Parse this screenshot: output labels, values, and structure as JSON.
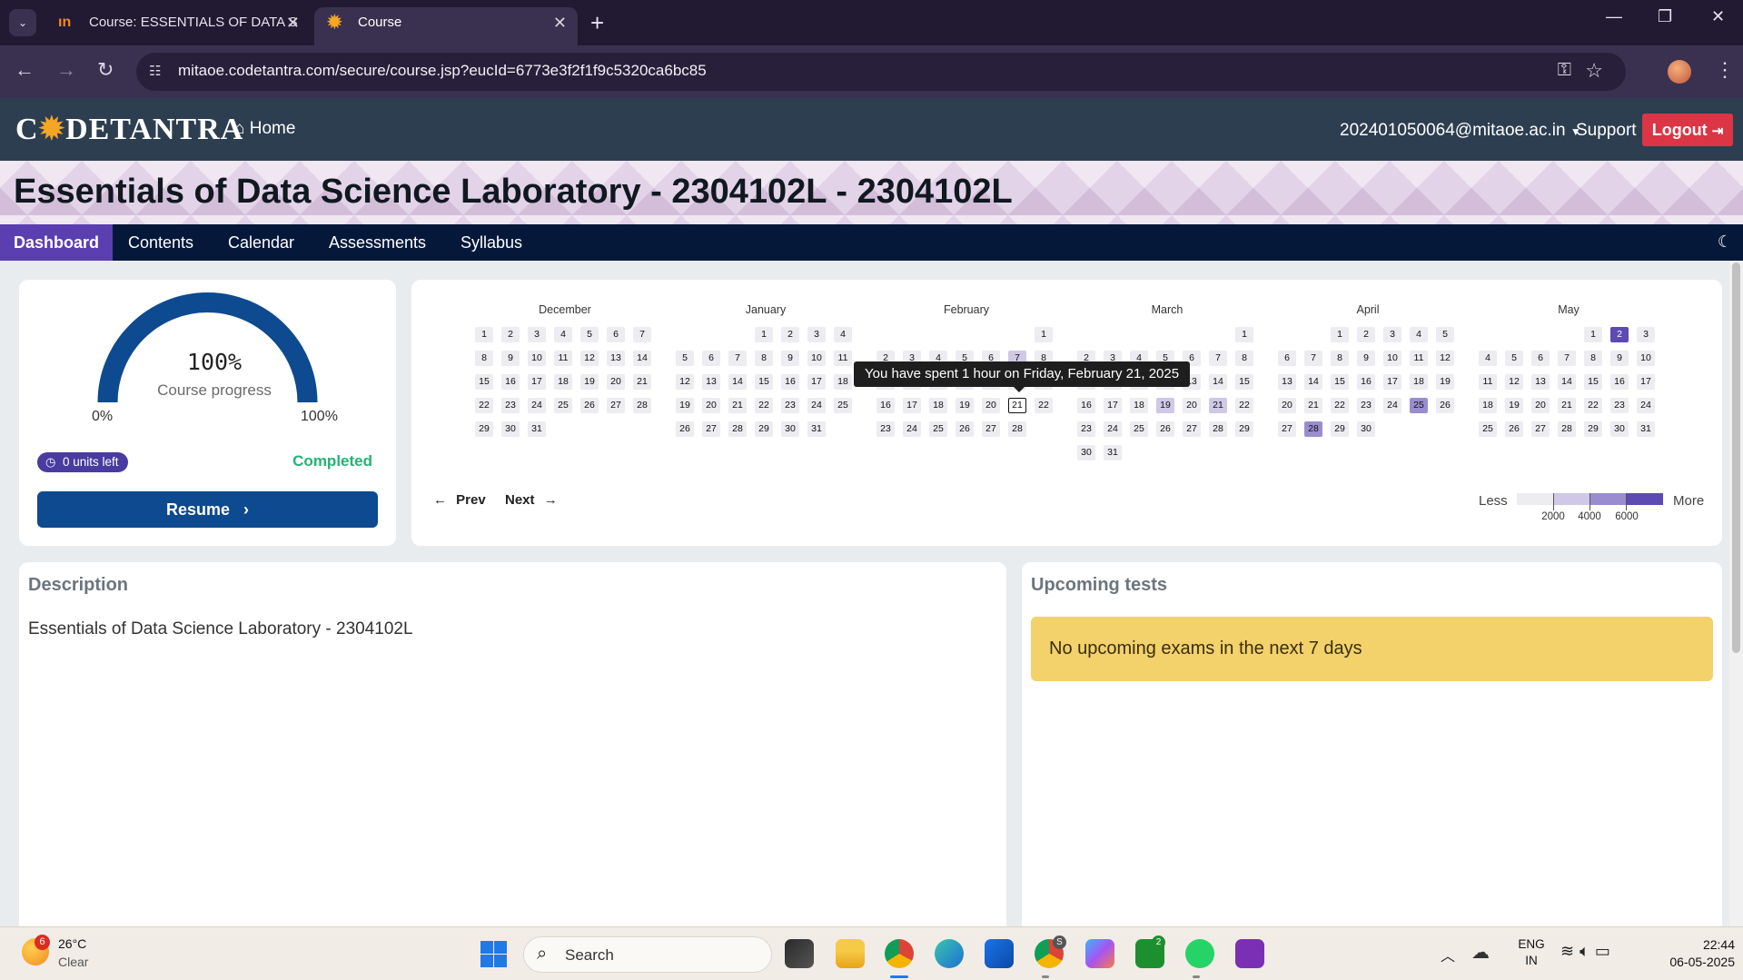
{
  "browser": {
    "tabs": [
      {
        "title": "Course: ESSENTIALS OF DATA S",
        "favicon": "codetantra-favicon"
      },
      {
        "title": "Course",
        "favicon": "sun-favicon",
        "active": true
      }
    ],
    "url": "mitaoe.codetantra.com/secure/course.jsp?eucId=6773e3f2f1f9c5320ca6bc85"
  },
  "header": {
    "logo": {
      "pre": "C",
      "sun": "✹",
      "post": "DETANTRA"
    },
    "home_label": "Home",
    "user": "202401050064@mitaoe.ac.in",
    "support_label": "Support",
    "logout_label": "Logout"
  },
  "course": {
    "title": "Essentials of Data Science Laboratory - 2304102L - 2304102L",
    "nav": [
      "Dashboard",
      "Contents",
      "Calendar",
      "Assessments",
      "Syllabus"
    ],
    "active_nav": "Dashboard"
  },
  "progress": {
    "percent_text": "100%",
    "value": 1.0,
    "label": "Course progress",
    "min_label": "0%",
    "max_label": "100%",
    "units_left": "0 units left",
    "status": "Completed",
    "resume_label": "Resume",
    "accent": "#0d4a8f"
  },
  "calendar": {
    "months": [
      {
        "name": "December",
        "first_weekday": 0,
        "days": 31
      },
      {
        "name": "January",
        "first_weekday": 3,
        "days": 31
      },
      {
        "name": "February",
        "first_weekday": 6,
        "days": 28
      },
      {
        "name": "March",
        "first_weekday": 6,
        "days": 31
      },
      {
        "name": "April",
        "first_weekday": 2,
        "days": 30
      },
      {
        "name": "May",
        "first_weekday": 4,
        "days": 31
      }
    ],
    "activity": [
      {
        "month": 2,
        "day": 7,
        "level": 1
      },
      {
        "month": 3,
        "day": 19,
        "level": 1
      },
      {
        "month": 3,
        "day": 21,
        "level": 1
      },
      {
        "month": 4,
        "day": 25,
        "level": 2
      },
      {
        "month": 4,
        "day": 28,
        "level": 2
      },
      {
        "month": 5,
        "day": 2,
        "level": 3
      }
    ],
    "highlighted": {
      "month": 2,
      "day": 21
    },
    "tooltip": "You have spent 1 hour on Friday, February 21, 2025",
    "prev_label": "Prev",
    "next_label": "Next",
    "legend": {
      "less": "Less",
      "more": "More",
      "ticks": [
        "2000",
        "4000",
        "6000"
      ]
    },
    "colors": [
      "#ececf1",
      "#cfc8e6",
      "#9a8dcf",
      "#5e4ab3"
    ]
  },
  "description": {
    "heading": "Description",
    "text": "Essentials of Data Science Laboratory - 2304102L"
  },
  "tests": {
    "heading": "Upcoming tests",
    "alert": "No upcoming exams in the next 7 days"
  },
  "taskbar": {
    "weather": {
      "temp": "26°C",
      "condition": "Clear",
      "badge": "6"
    },
    "search_placeholder": "Search",
    "apps": [
      "task-view",
      "file-explorer",
      "chrome",
      "edge",
      "microsoft-store",
      "chrome-profile",
      "copilot",
      "xbox",
      "whatsapp",
      "app"
    ],
    "lang": {
      "line1": "ENG",
      "line2": "IN"
    },
    "time": "22:44",
    "date": "06-05-2025"
  }
}
